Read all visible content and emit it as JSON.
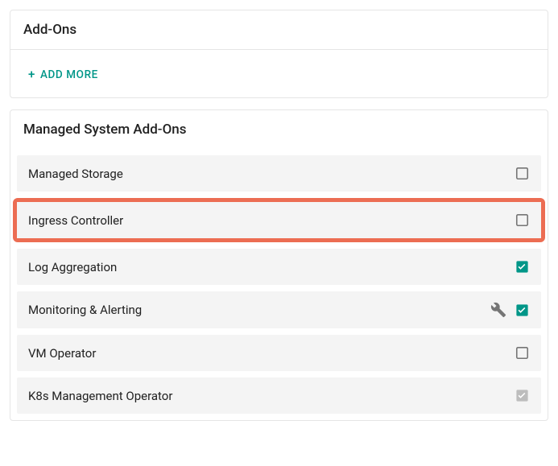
{
  "colors": {
    "accent": "#009688",
    "highlight": "#ec6d53",
    "checkbox_border": "#757575",
    "checkbox_disabled": "#bdbdbd"
  },
  "addons_card": {
    "title": "Add-Ons",
    "add_more_label": "ADD MORE"
  },
  "managed_card": {
    "title": "Managed System Add-Ons",
    "items": [
      {
        "label": "Managed Storage",
        "checked": false,
        "highlighted": false,
        "has_settings": false,
        "disabled": false
      },
      {
        "label": "Ingress Controller",
        "checked": false,
        "highlighted": true,
        "has_settings": false,
        "disabled": false
      },
      {
        "label": "Log Aggregation",
        "checked": true,
        "highlighted": false,
        "has_settings": false,
        "disabled": false
      },
      {
        "label": "Monitoring & Alerting",
        "checked": true,
        "highlighted": false,
        "has_settings": true,
        "disabled": false
      },
      {
        "label": "VM Operator",
        "checked": false,
        "highlighted": false,
        "has_settings": false,
        "disabled": false
      },
      {
        "label": "K8s Management Operator",
        "checked": true,
        "highlighted": false,
        "has_settings": false,
        "disabled": true
      }
    ]
  }
}
